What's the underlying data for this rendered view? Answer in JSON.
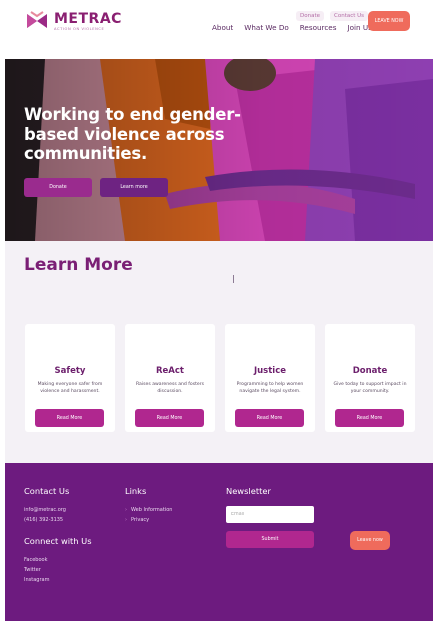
{
  "brand": {
    "name": "METRAC",
    "tagline": "ACTION ON VIOLENCE",
    "color": "#8a1f71"
  },
  "header": {
    "util_links": [
      "Donate",
      "Contact Us"
    ],
    "nav": [
      "About",
      "What We Do",
      "Resources",
      "Join Us"
    ],
    "leave_label": "LEAVE NOW"
  },
  "hero": {
    "title": "Working to end gender-based violence across communities.",
    "donate_label": "Donate",
    "learn_label": "Learn more"
  },
  "learn": {
    "title": "Learn More",
    "cards": [
      {
        "title": "Safety",
        "desc": "Making everyone safer from violence and harassment.",
        "button": "Read More"
      },
      {
        "title": "ReAct",
        "desc": "Raises awareness and fosters discussion.",
        "button": "Read More"
      },
      {
        "title": "Justice",
        "desc": "Programming to help women navigate the legal system.",
        "button": "Read More"
      },
      {
        "title": "Donate",
        "desc": "Give today to support impact in your community.",
        "button": "Read More"
      }
    ]
  },
  "footer": {
    "contact_heading": "Contact Us",
    "email": "info@metrac.org",
    "phone": "(416) 392-3135",
    "connect_heading": "Connect with Us",
    "social": [
      "Facebook",
      "Twitter",
      "Instagram"
    ],
    "links_heading": "Links",
    "links": [
      "Web Information",
      "Privacy"
    ],
    "newsletter_heading": "Newsletter",
    "email_placeholder": "Email",
    "submit_label": "Submit",
    "leave_label": "Leave now"
  },
  "colors": {
    "accent": "#b0278f",
    "leave": "#ef6b5c",
    "footer_bg": "#6d1b7f"
  }
}
